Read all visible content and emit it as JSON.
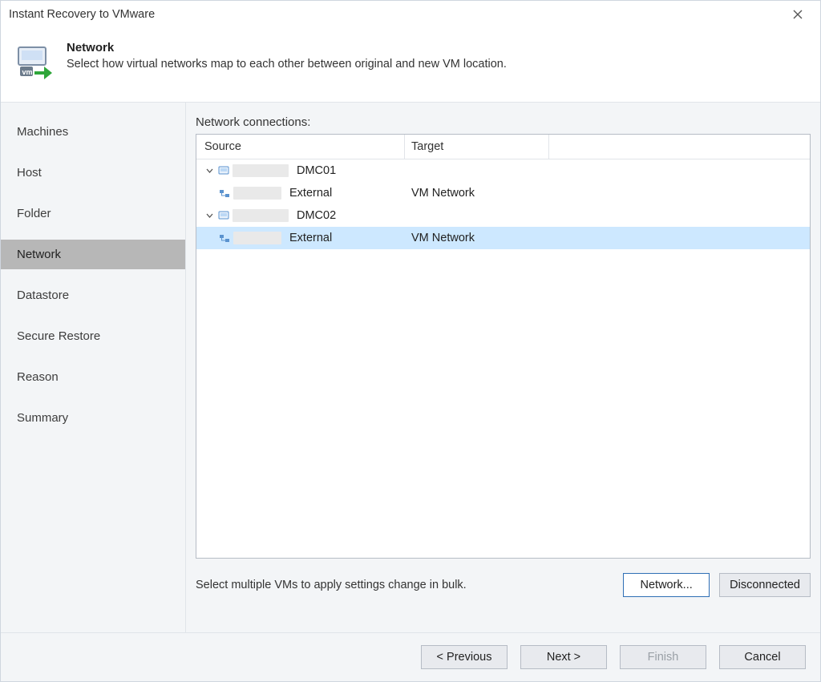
{
  "window": {
    "title": "Instant Recovery to VMware"
  },
  "header": {
    "title": "Network",
    "subtitle": "Select how virtual networks map to each other between original and new VM location."
  },
  "sidebar": {
    "items": [
      {
        "label": "Machines"
      },
      {
        "label": "Host"
      },
      {
        "label": "Folder"
      },
      {
        "label": "Network",
        "selected": true
      },
      {
        "label": "Datastore"
      },
      {
        "label": "Secure Restore"
      },
      {
        "label": "Reason"
      },
      {
        "label": "Summary"
      }
    ]
  },
  "main": {
    "label": "Network connections:",
    "columns": {
      "source": "Source",
      "target": "Target"
    },
    "rows": [
      {
        "type": "vm",
        "level": 0,
        "source_text": "DMC01",
        "target_text": ""
      },
      {
        "type": "net",
        "level": 1,
        "source_text": "External",
        "target_text": "VM Network"
      },
      {
        "type": "vm",
        "level": 0,
        "source_text": "DMC02",
        "target_text": ""
      },
      {
        "type": "net",
        "level": 1,
        "source_text": "External",
        "target_text": "VM Network",
        "selected": true
      }
    ],
    "hint": "Select multiple VMs to apply settings change in bulk.",
    "buttons": {
      "network": "Network...",
      "disconnected": "Disconnected"
    }
  },
  "wizard": {
    "previous": "< Previous",
    "next": "Next >",
    "finish": "Finish",
    "cancel": "Cancel"
  }
}
